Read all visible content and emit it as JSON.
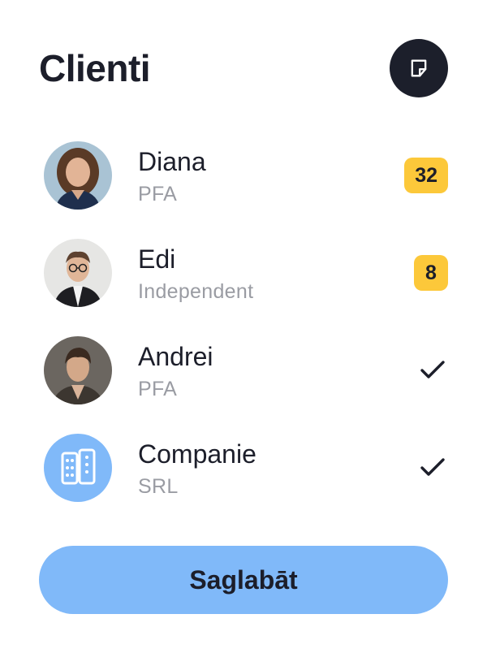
{
  "header": {
    "title": "Clienti",
    "note_icon": "sticky-note-icon"
  },
  "clients": [
    {
      "name": "Diana",
      "type": "PFA",
      "badge": "32",
      "status_icon": null,
      "avatar": "photo-diana"
    },
    {
      "name": "Edi",
      "type": "Independent",
      "badge": "8",
      "status_icon": null,
      "avatar": "photo-edi"
    },
    {
      "name": "Andrei",
      "type": "PFA",
      "badge": null,
      "status_icon": "check-icon",
      "avatar": "photo-andrei"
    },
    {
      "name": "Companie",
      "type": "SRL",
      "badge": null,
      "status_icon": "check-icon",
      "avatar": "building-icon"
    }
  ],
  "footer": {
    "save_label": "Saglabāt"
  },
  "colors": {
    "accent": "#80b9f9",
    "badge": "#fcc83a",
    "dark": "#1c1f2b",
    "muted": "#9a9ca3"
  }
}
